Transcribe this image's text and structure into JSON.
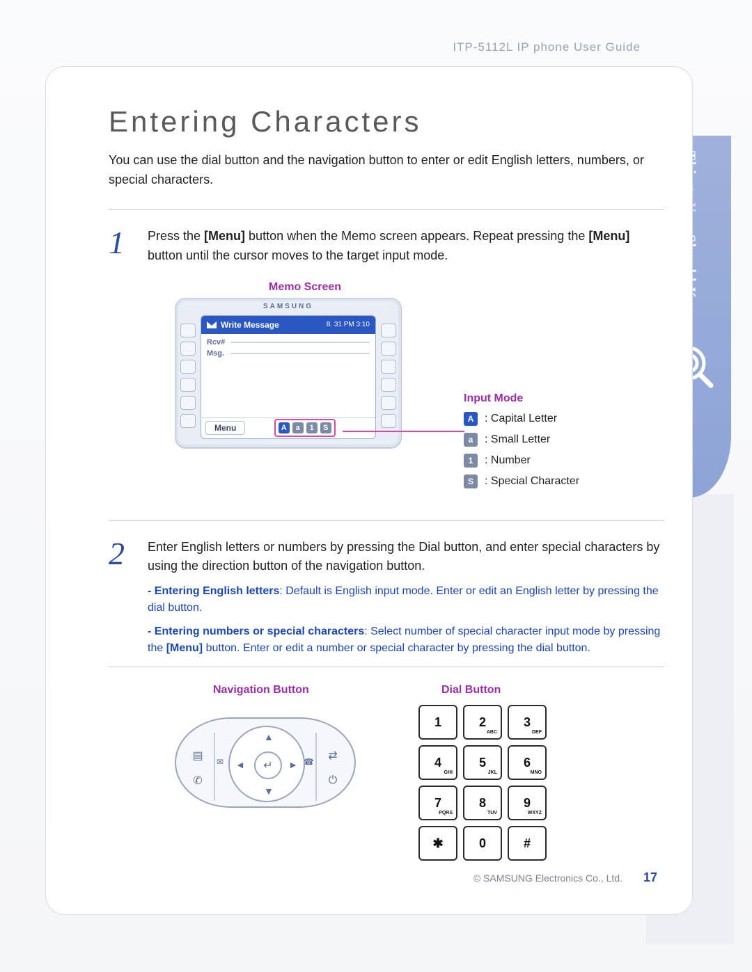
{
  "header": {
    "guide_title": "ITP-5112L IP phone User Guide"
  },
  "side_tab": {
    "line1": "Things",
    "line2": "You",
    "line3": "Should Know"
  },
  "title": "Entering Characters",
  "intro": "You can use the dial button and the navigation button to enter or edit English letters, numbers, or special characters.",
  "steps": [
    {
      "num": "1",
      "text_pre": "Press the ",
      "bold1": "[Menu]",
      "text_mid": " button when the Memo screen appears. Repeat pressing the ",
      "bold2": "[Menu]",
      "text_post": " button until the cursor moves to the target input mode."
    },
    {
      "num": "2",
      "text": "Enter English letters or numbers by pressing the Dial button, and enter special characters by using the direction button of the navigation button.",
      "subs": [
        {
          "lead": "- Entering English letters",
          "rest": ": Default is English input mode. Enter or edit an English letter by pressing the dial button."
        },
        {
          "lead": "- Entering numbers or special characters",
          "rest_pre": ": Select number of special character input mode by pressing the ",
          "bold": "[Menu]",
          "rest_post": " button. Enter or edit a number or special character by pressing the dial button."
        }
      ]
    }
  ],
  "memo": {
    "title": "Memo Screen",
    "brand": "SAMSUNG",
    "header_title": "Write Message",
    "header_time": "8. 31  PM 3:10",
    "row1": "Rcv#",
    "row2": "Msg.",
    "menu_label": "Menu",
    "modes": [
      "A",
      "a",
      "1",
      "S"
    ]
  },
  "input_mode": {
    "title": "Input Mode",
    "items": [
      {
        "badge": "A",
        "style": "blue",
        "label": ": Capital Letter"
      },
      {
        "badge": "a",
        "style": "gray",
        "label": ": Small Letter"
      },
      {
        "badge": "1",
        "style": "gray",
        "label": ": Number"
      },
      {
        "badge": "S",
        "style": "gray",
        "label": ": Special Character"
      }
    ]
  },
  "nav_button": {
    "title": "Navigation Button",
    "center": "↵",
    "arrows": {
      "up": "▲",
      "down": "▼",
      "left": "◄",
      "right": "►"
    },
    "side_icons": {
      "l1": "▤",
      "l2": "✆",
      "r1": "⇄",
      "r2": "⏻"
    },
    "slot_left": "✉",
    "slot_right": "☎"
  },
  "dial_button": {
    "title": "Dial Button",
    "keys": [
      {
        "main": "1",
        "sub": ""
      },
      {
        "main": "2",
        "sub": "ABC"
      },
      {
        "main": "3",
        "sub": "DEF"
      },
      {
        "main": "4",
        "sub": "GHI"
      },
      {
        "main": "5",
        "sub": "JKL"
      },
      {
        "main": "6",
        "sub": "MNO"
      },
      {
        "main": "7",
        "sub": "PQRS"
      },
      {
        "main": "8",
        "sub": "TUV"
      },
      {
        "main": "9",
        "sub": "WXYZ"
      },
      {
        "main": "✱",
        "sub": ""
      },
      {
        "main": "0",
        "sub": ""
      },
      {
        "main": "#",
        "sub": ""
      }
    ]
  },
  "footer": {
    "copyright": "© SAMSUNG Electronics Co., Ltd.",
    "page": "17"
  }
}
